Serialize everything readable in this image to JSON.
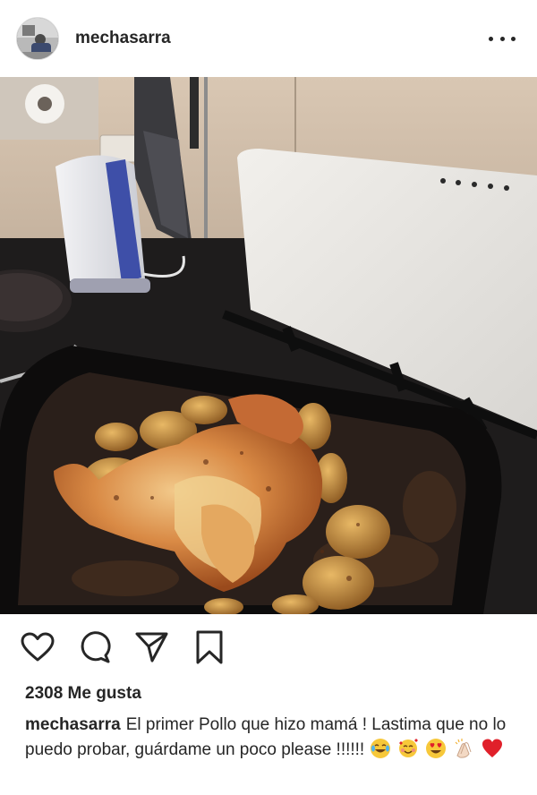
{
  "header": {
    "username": "mechasarra",
    "more_label": "More options"
  },
  "photo": {
    "description_icon": "roast-chicken-photo"
  },
  "actions": {
    "like_icon": "heart-icon",
    "comment_icon": "comment-icon",
    "share_icon": "send-icon",
    "save_icon": "bookmark-icon"
  },
  "likes": {
    "text": "2308 Me gusta"
  },
  "caption": {
    "username": "mechasarra",
    "text": "El primer Pollo que hizo mamá ! Lastima que no lo puedo probar, guárdame un poco please !!!!!!",
    "emojis": [
      "tears-of-joy-emoji",
      "smiling-face-hearts-emoji",
      "heart-eyes-emoji",
      "clapping-hands-emoji",
      "red-heart-emoji"
    ]
  },
  "colors": {
    "text": "#262626",
    "background": "#ffffff",
    "heart": "#e0202a"
  }
}
